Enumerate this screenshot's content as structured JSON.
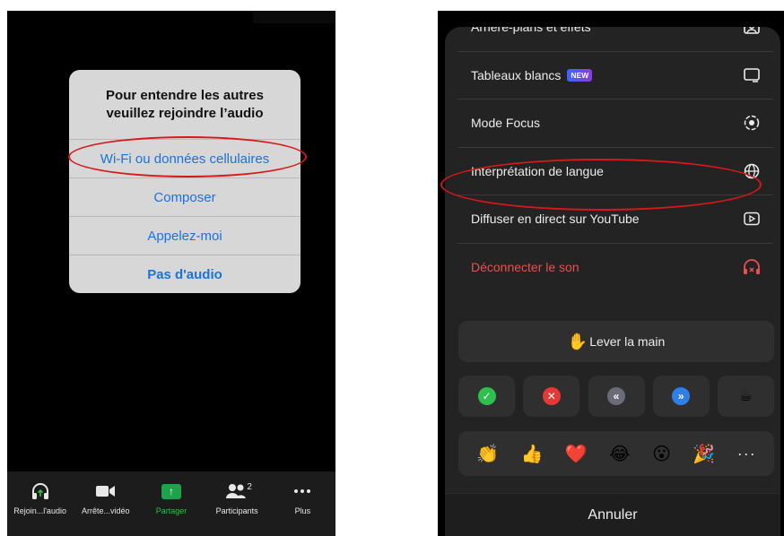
{
  "left": {
    "dialog": {
      "title": "Pour entendre les autres veuillez rejoindre l’audio",
      "options": [
        {
          "label": "Wi-Fi ou données cellulaires",
          "bold": false
        },
        {
          "label": "Composer",
          "bold": false
        },
        {
          "label": "Appelez-moi",
          "bold": false
        },
        {
          "label": "Pas d'audio",
          "bold": true
        }
      ]
    },
    "toolbar": [
      {
        "label": "Rejoin...l'audio",
        "icon": "headphones-icon"
      },
      {
        "label": "Arrête...vidéo",
        "icon": "video-camera-icon"
      },
      {
        "label": "Partager",
        "icon": "share-screen-icon"
      },
      {
        "label": "Participants",
        "icon": "participants-icon",
        "count": "2"
      },
      {
        "label": "Plus",
        "icon": "more-icon"
      }
    ]
  },
  "right": {
    "menu": [
      {
        "label": "Arrière-plans et effets",
        "icon": "background-effects-icon"
      },
      {
        "label": "Tableaux blancs",
        "badge": "NEW",
        "icon": "whiteboard-icon"
      },
      {
        "label": "Mode Focus",
        "icon": "focus-mode-icon"
      },
      {
        "label": "Interprétation de langue",
        "icon": "globe-icon"
      },
      {
        "label": "Diffuser en direct sur YouTube",
        "icon": "live-stream-icon"
      },
      {
        "label": "Déconnecter le son",
        "icon": "disconnect-audio-icon",
        "color": "#e85151"
      }
    ],
    "raise_hand": {
      "label": "Lever la main",
      "emoji": "✋"
    },
    "reactions": [
      {
        "name": "yes-icon",
        "glyph": "✓",
        "color": "#2fbf4f"
      },
      {
        "name": "no-icon",
        "glyph": "✕",
        "color": "#e53935"
      },
      {
        "name": "slower-icon",
        "glyph": "«",
        "color": "#6b6b7a"
      },
      {
        "name": "faster-icon",
        "glyph": "»",
        "color": "#2f7fe8"
      },
      {
        "name": "coffee-icon",
        "glyph": "☕",
        "color": ""
      }
    ],
    "emojis": [
      "👏",
      "👍",
      "❤️",
      "😂",
      "😮",
      "🎉"
    ],
    "more": "···",
    "cancel": "Annuler"
  },
  "colors": {
    "annotation": "#d81818",
    "link": "#1a73d9",
    "sheet": "#232323"
  }
}
